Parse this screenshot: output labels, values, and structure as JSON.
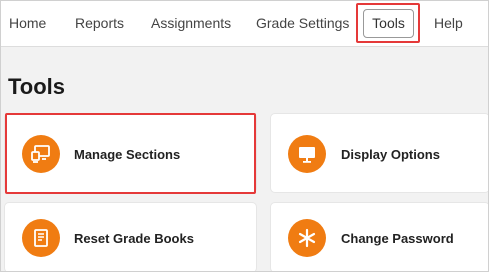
{
  "nav": {
    "items": [
      {
        "label": "Home"
      },
      {
        "label": "Reports"
      },
      {
        "label": "Assignments"
      },
      {
        "label": "Grade Settings"
      },
      {
        "label": "Tools",
        "active": true
      },
      {
        "label": "Help"
      }
    ]
  },
  "page": {
    "title": "Tools"
  },
  "cards": [
    {
      "label": "Manage Sections",
      "icon": "manage-sections-icon"
    },
    {
      "label": "Display Options",
      "icon": "monitor-icon"
    },
    {
      "label": "Reset Grade Books",
      "icon": "book-icon"
    },
    {
      "label": "Change Password",
      "icon": "asterisk-icon"
    }
  ],
  "colors": {
    "accent": "#f07c12",
    "highlight": "#e53939"
  }
}
